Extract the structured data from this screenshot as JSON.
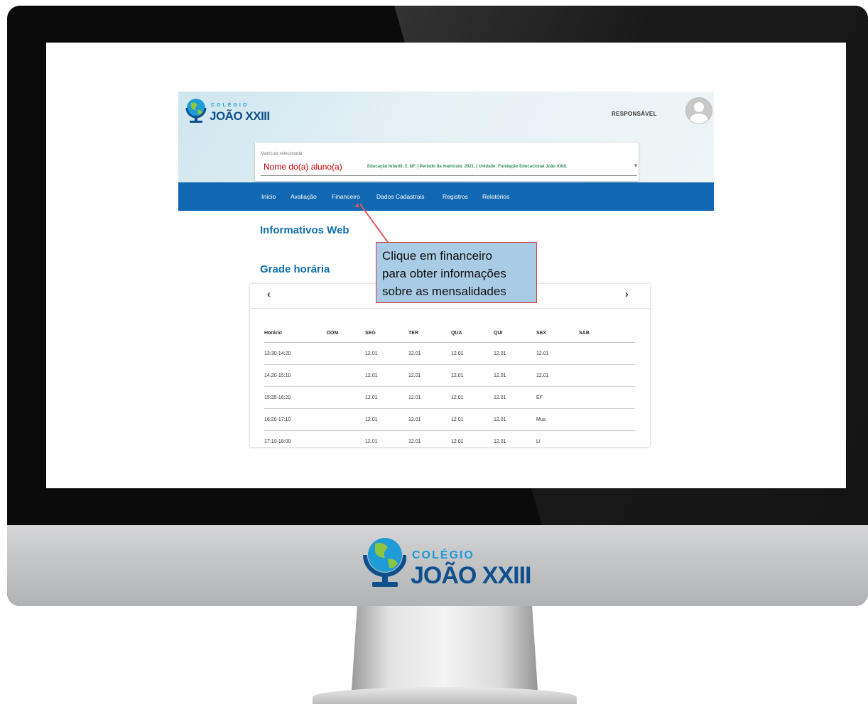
{
  "brand": {
    "colegio": "COLÉGIO",
    "name": "JOÃO XXIII"
  },
  "header": {
    "role": "RESPONSÁVEL",
    "avatar_icon": "user-avatar-icon"
  },
  "matricula": {
    "label": "Matrícula selecionada",
    "student_name": "Nome do(a) aluno(a)",
    "info": "Educação Infantil, 2. NF. | Período da matrícula: 2021. | Unidade: Fundação Educacional João XXIII.",
    "dropdown_icon": "caret-down-icon"
  },
  "nav": {
    "items": [
      {
        "label": "Início"
      },
      {
        "label": "Avaliação"
      },
      {
        "label": "Financeiro"
      },
      {
        "label": "Dados Cadastrais"
      },
      {
        "label": "Registros"
      },
      {
        "label": "Relatórios"
      }
    ]
  },
  "sections": {
    "informativos": "Informativos Web",
    "grade": "Grade horária"
  },
  "callout": {
    "line1": "Clique em financeiro",
    "line2": "para obter informações",
    "line3": "sobre as mensalidades"
  },
  "grade": {
    "prev_icon": "chevron-left-icon",
    "next_icon": "chevron-right-icon",
    "prev_glyph": "‹",
    "next_glyph": "›",
    "headers": [
      "Horário",
      "DOM",
      "SEG",
      "TER",
      "QUA",
      "QUI",
      "SEX",
      "SÁB"
    ],
    "rows": [
      [
        "13:30-14:20",
        "",
        "12.01",
        "12.01",
        "12.01",
        "12.01",
        "12.01",
        ""
      ],
      [
        "14:20-15:10",
        "",
        "12.01",
        "12.01",
        "12.01",
        "12.01",
        "12.01",
        ""
      ],
      [
        "15:35-16:20",
        "",
        "12.01",
        "12.01",
        "12.01",
        "12.01",
        "EF",
        ""
      ],
      [
        "16:20-17:10",
        "",
        "12.01",
        "12.01",
        "12.01",
        "12.01",
        "Mus",
        ""
      ],
      [
        "17:10-18:00",
        "",
        "12.01",
        "12.01",
        "12.01",
        "12.01",
        "LI",
        ""
      ]
    ]
  },
  "colors": {
    "nav_blue": "#1167b1",
    "title_blue": "#0f6fae",
    "student_red": "#cc0000",
    "info_green": "#2e8b57",
    "callout_fill": "#a8cbe6",
    "callout_border": "#d04040"
  }
}
